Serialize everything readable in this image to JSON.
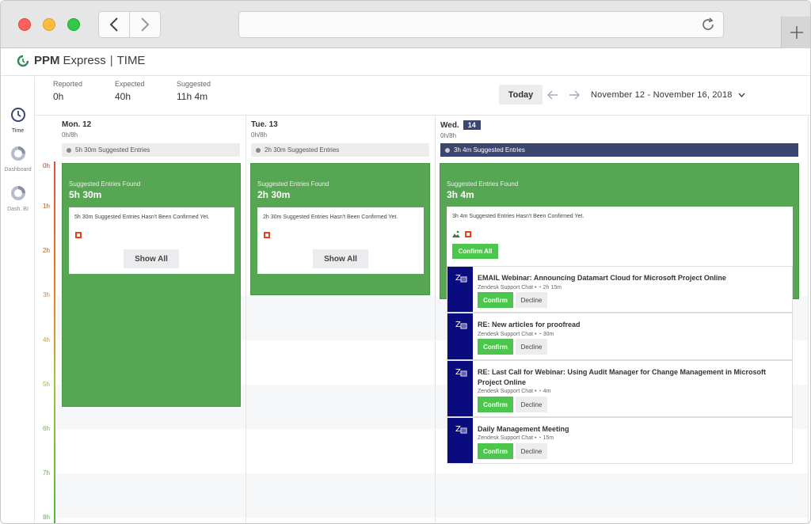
{
  "app": {
    "brand_bold": "PPM",
    "brand_light": "Express",
    "separator": "|",
    "product": "TIME"
  },
  "sidebar": {
    "items": [
      {
        "label": "Time",
        "icon": "clock-icon",
        "active": true
      },
      {
        "label": "Dashboard",
        "icon": "donut-chart-icon",
        "active": false
      },
      {
        "label": "Dash. BI",
        "icon": "donut-chart-icon",
        "active": false
      }
    ]
  },
  "summary": {
    "reported_label": "Reported",
    "reported_value": "0h",
    "expected_label": "Expected",
    "expected_value": "40h",
    "suggested_label": "Suggested",
    "suggested_value": "11h 4m"
  },
  "toolbar": {
    "today": "Today",
    "date_range": "November 12 - November 16, 2018"
  },
  "hours": [
    "0h",
    "1h",
    "2h",
    "3h",
    "4h",
    "5h",
    "6h",
    "7h",
    "8h"
  ],
  "days": [
    {
      "name": "Mon. 12",
      "hours": "0h/8h",
      "suggested_bar": "5h 30m Suggested Entries",
      "box_title": "Suggested Entries Found",
      "box_hours": "5h 30m",
      "card_text": "5h 30m Suggested Entries Hasn't Been Confirmed Yet.",
      "show_all": "Show All"
    },
    {
      "name": "Tue. 13",
      "hours": "0h/8h",
      "suggested_bar": "2h 30m Suggested Entries",
      "box_title": "Suggested Entries Found",
      "box_hours": "2h 30m",
      "card_text": "2h 30m Suggested Entries Hasn't Been Confirmed Yet.",
      "show_all": "Show All"
    },
    {
      "name": "Wed.",
      "badge": "14",
      "hours": "0h/8h",
      "suggested_bar": "3h 4m Suggested Entries",
      "box_title": "Suggested Entries Found",
      "box_hours": "3h 4m",
      "card_text": "3h 4m Suggested Entries Hasn't Been Confirmed Yet.",
      "confirm_all": "Confirm All"
    }
  ],
  "entries": [
    {
      "title": "EMAIL Webinar: Announcing Datamart Cloud for Microsoft Project Online",
      "source": "Zendesk Support Chat",
      "duration": "2h 15m",
      "confirm": "Confirm",
      "decline": "Decline"
    },
    {
      "title": "RE: New articles for proofread",
      "source": "Zendesk Support Chat",
      "duration": "30m",
      "confirm": "Confirm",
      "decline": "Decline"
    },
    {
      "title": "RE: Last Call for Webinar: Using Audit Manager for Change Management in Microsoft Project Online",
      "source": "Zendesk Support Chat",
      "duration": "4m",
      "confirm": "Confirm",
      "decline": "Decline"
    },
    {
      "title": "Daily Management Meeting",
      "source": "Zendesk Support Chat",
      "duration": "15m",
      "confirm": "Confirm",
      "decline": "Decline"
    }
  ],
  "colors": {
    "accent_navy": "#3c4470",
    "suggest_green": "#56a653",
    "confirm_green": "#4cc64c",
    "entry_icon_bg": "#0b0b80"
  }
}
